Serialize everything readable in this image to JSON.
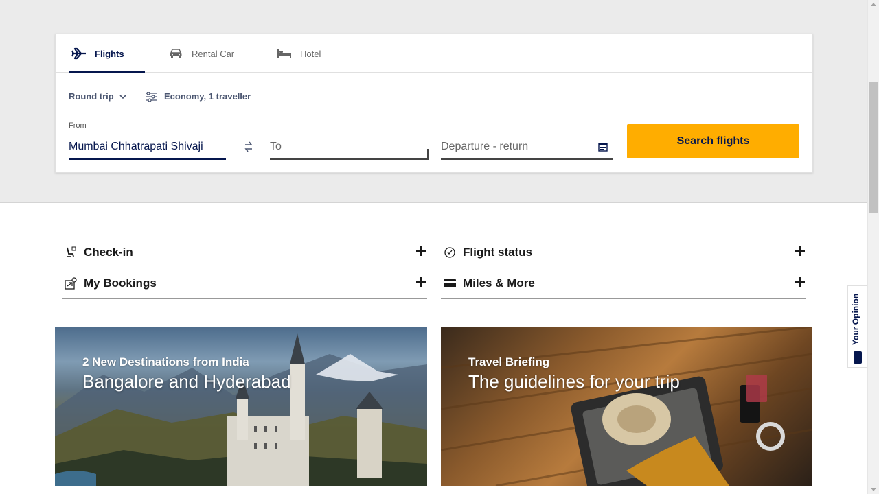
{
  "tabs": [
    {
      "label": "Flights",
      "icon": "airplane-icon"
    },
    {
      "label": "Rental Car",
      "icon": "car-icon"
    },
    {
      "label": "Hotel",
      "icon": "bed-icon"
    }
  ],
  "search": {
    "trip_type": "Round trip",
    "cabin": "Economy, 1 traveller",
    "from_label": "From",
    "from_value": "Mumbai Chhatrapati Shivaji",
    "to_placeholder": "To",
    "date_placeholder": "Departure - return",
    "button_label": "Search flights"
  },
  "quick_links": [
    {
      "label": "Check-in",
      "icon": "checkin-seat-icon"
    },
    {
      "label": "Flight status",
      "icon": "clock-icon"
    },
    {
      "label": "My Bookings",
      "icon": "booking-icon"
    },
    {
      "label": "Miles & More",
      "icon": "card-icon"
    }
  ],
  "teasers": [
    {
      "kicker": "2 New Destinations from India",
      "headline": "Bangalore and Hyderabad"
    },
    {
      "kicker": "Travel Briefing",
      "headline": "The guidelines for your trip"
    }
  ],
  "feedback": {
    "label": "Your Opinion"
  },
  "colors": {
    "brand_navy": "#05164d",
    "accent_yellow": "#ffad00",
    "band_gray": "#ebebeb"
  }
}
